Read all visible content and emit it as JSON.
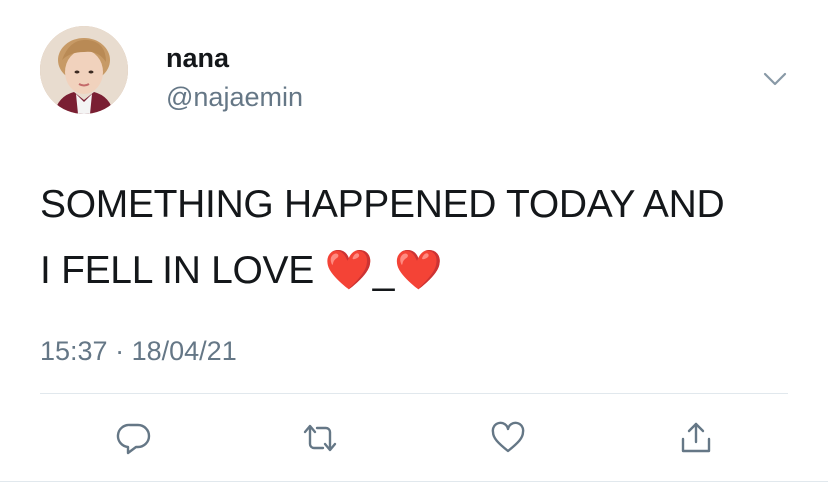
{
  "author": {
    "display_name": "nana",
    "handle": "@najaemin"
  },
  "tweet": {
    "line1": "SOMETHING HAPPENED TODAY AND",
    "line2_text": "I FELL IN LOVE ",
    "line2_emoji1": "❤️",
    "line2_sep": "_",
    "line2_emoji2": "❤️"
  },
  "meta": {
    "time": "15:37",
    "separator": "·",
    "date": "18/04/21"
  },
  "actions": [
    "reply-icon",
    "retweet-icon",
    "like-icon",
    "share-icon"
  ],
  "colors": {
    "text": "#14171a",
    "secondary": "#657786",
    "icon": "#657786",
    "divider": "#e1e8ed"
  }
}
